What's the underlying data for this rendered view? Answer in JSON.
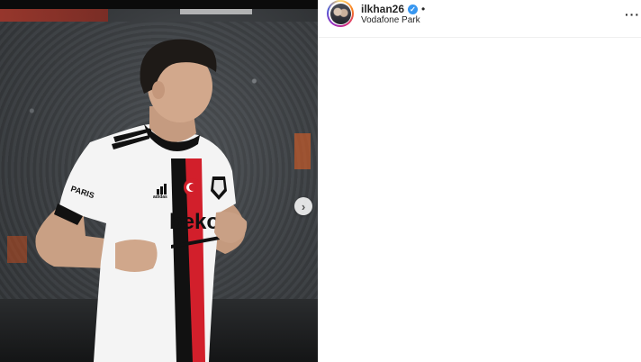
{
  "post": {
    "username": "ilkhan26",
    "verified_icon": "verified-badge-icon",
    "separator": "•",
    "location": "Vodafone Park",
    "more_icon": "more-options-icon",
    "more_label": "···",
    "next_icon": "chevron-right-icon",
    "next_label": "›"
  },
  "photo": {
    "jersey_sponsor": "beko",
    "jersey_brand": "adidas",
    "jersey_side_text": "PARIS"
  },
  "colors": {
    "verified": "#3897f0",
    "jersey_red": "#d21f2b",
    "jersey_black": "#111111"
  }
}
